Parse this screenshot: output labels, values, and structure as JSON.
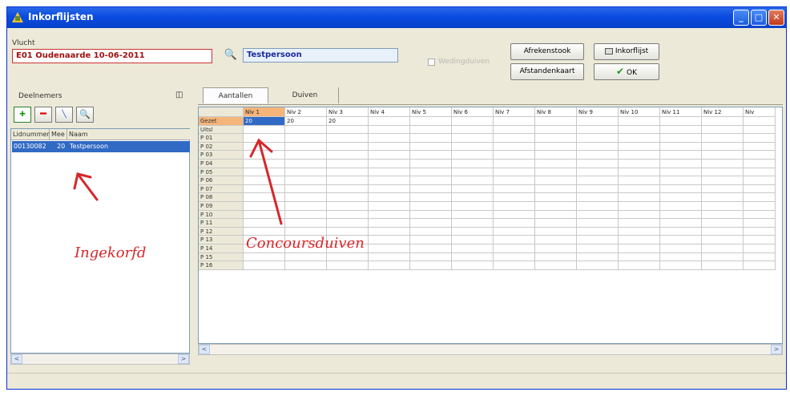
{
  "window": {
    "title": "Inkorflijsten"
  },
  "flight": {
    "label": "Vlucht",
    "value": "E01 Oudenaarde 10-06-2011",
    "person": "Testpersoon",
    "checkbox_label": "Wedingduiven"
  },
  "buttons": {
    "afrekenstook": "Afrekenstook",
    "afstandenkaart": "Afstandenkaart",
    "inkorflijst": "Inkorflijst",
    "ok": "OK"
  },
  "participants": {
    "title": "Deelnemers",
    "columns": [
      "Lidnummer",
      "Mee",
      "Naam"
    ],
    "rows": [
      {
        "lidnummer": "00130082",
        "mee": "20",
        "naam": "Testpersoon"
      }
    ]
  },
  "tabs": [
    "Aantallen",
    "Duiven"
  ],
  "grid": {
    "columns": [
      "Niv 1",
      "Niv 2",
      "Niv 3",
      "Niv 4",
      "Niv 5",
      "Niv 6",
      "Niv 7",
      "Niv 8",
      "Niv 9",
      "Niv 10",
      "Niv 11",
      "Niv 12",
      "Niv"
    ],
    "rows": [
      "Gezet",
      "Uitsl",
      "P 01",
      "P 02",
      "P 03",
      "P 04",
      "P 05",
      "P 06",
      "P 07",
      "P 08",
      "P 09",
      "P 10",
      "P 11",
      "P 12",
      "P 13",
      "P 14",
      "P 15",
      "P 16"
    ],
    "gezet_values": [
      "20",
      "20",
      "20"
    ]
  },
  "annotations": {
    "left": "Ingekorfd",
    "right": "Concoursduiven"
  },
  "colors": {
    "selection": "#316ac5",
    "highlight_header": "#f5b57a",
    "arrow": "#d6262a"
  }
}
